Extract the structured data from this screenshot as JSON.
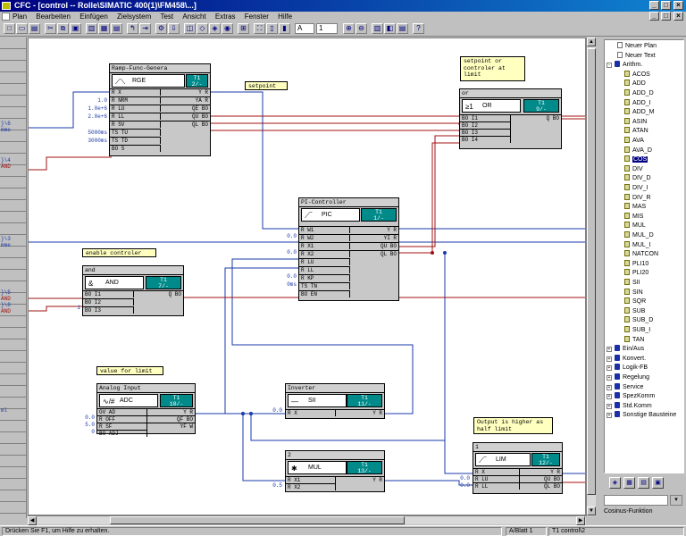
{
  "window": {
    "title": "CFC - [control -- Rolle\\SIMATIC 400(1)\\FM458\\...]",
    "min": "_",
    "max": "□",
    "close": "×",
    "inner_min": "_",
    "inner_max": "□",
    "inner_close": "×"
  },
  "menu": [
    "Plan",
    "Bearbeiten",
    "Einfügen",
    "Zielsystem",
    "Test",
    "Ansicht",
    "Extras",
    "Fenster",
    "Hilfe"
  ],
  "toolbar": {
    "sheet_value": "A",
    "page_value": "1"
  },
  "ruler_labels": [
    {
      "id": "r1",
      "lines": [
        "}\\6",
        "mme"
      ]
    },
    {
      "id": "r2",
      "lines": [
        "}\\4",
        "AND"
      ]
    },
    {
      "id": "r3",
      "lines": [
        "}\\3",
        "mme"
      ]
    },
    {
      "id": "r4",
      "lines": [
        "}\\5",
        "AND",
        "}\\8",
        "AND"
      ]
    },
    {
      "id": "r5",
      "lines": [
        "ml"
      ]
    }
  ],
  "notes": {
    "setpoint": "setpoint",
    "or_note": "setpoint or\ncontroler at\nlimit",
    "enable": "enable controler",
    "value_limit": "value for limit",
    "output_limit": "Output is higher as\nhalf limit"
  },
  "blocks": {
    "ramp": {
      "header": "Ramp-Func-Genera",
      "symbol": "RGE",
      "num1": "T1",
      "num2": "2/-",
      "inputs": [
        "R  X",
        "R  NRM",
        "R  LU",
        "R  LL",
        "R  SV",
        "TS TU",
        "TS TD",
        "BO S"
      ],
      "outputs": [
        "Y  R",
        "YA  R",
        "QE BO",
        "QU BO",
        "QL BO"
      ],
      "input_values": {
        "nrm": "1.0",
        "lu": "1.0e+6",
        "ll": "2.0e+6",
        "tu": "5000ms",
        "td": "3000ms"
      }
    },
    "or": {
      "header": "or",
      "symbol": "OR",
      "num1": "T1",
      "num2": "9/-",
      "inputs": [
        "BO I1",
        "BO I2",
        "BO I3",
        "BO I4"
      ],
      "outputs": [
        "Q BO"
      ]
    },
    "pic": {
      "header": "PI-Controller",
      "symbol": "PIC",
      "num1": "T1",
      "num2": "1/-",
      "inputs": [
        "R  W1",
        "R  W2",
        "R  X1",
        "R  X2",
        "R  LU",
        "R  LL",
        "R  KP",
        "TS TN",
        "BO EN"
      ],
      "outputs": [
        "Y  R",
        "YI  R",
        "QU BO",
        "QL BO"
      ],
      "input_values": {
        "w2": "0.0",
        "x2": "0.0",
        "kp": "0.0",
        "tn": "0ms"
      }
    },
    "and": {
      "header": "and",
      "symbol": "AND",
      "num1": "T1",
      "num2": "7/-",
      "inputs": [
        "BO I1",
        "BO I2",
        "BO I3"
      ],
      "outputs": [
        "Q BO"
      ],
      "input_values": {
        "i3": "1"
      }
    },
    "adc": {
      "header": "Analog Input",
      "symbol": "ADC",
      "num1": "T1",
      "num2": "10/-",
      "inputs": [
        "GV AD",
        "R  OFF",
        "R  SF",
        "BO ADJ"
      ],
      "outputs": [
        "Y  R",
        "QF BO",
        "YF  W"
      ],
      "input_values": {
        "off": "0.0",
        "sf": "5.0",
        "adj": "0"
      }
    },
    "inv": {
      "header": "Inverter",
      "symbol": "SII",
      "num1": "T1",
      "num2": "11/-",
      "inputs": [
        "R  X"
      ],
      "outputs": [
        "Y  R"
      ],
      "input_values": {
        "x": "0.0"
      }
    },
    "mul": {
      "header": "2",
      "symbol": "MUL",
      "num1": "T1",
      "num2": "13/-",
      "inputs": [
        "R  X1",
        "R  X2"
      ],
      "outputs": [
        "Y  R"
      ],
      "input_values": {
        "x2": "0.5"
      }
    },
    "lim": {
      "header": "1",
      "symbol": "LIM",
      "num1": "T1",
      "num2": "12/-",
      "inputs": [
        "R  X",
        "R  LU",
        "R  LL"
      ],
      "outputs": [
        "Y  R",
        "QU BO",
        "QL BO"
      ],
      "input_values": {
        "lu": "0.0",
        "ll": "0.0"
      }
    }
  },
  "catalog": {
    "items": [
      {
        "label": "Neuer Plan",
        "icon": "page"
      },
      {
        "label": "Neuer Text",
        "icon": "page"
      },
      {
        "label": "Arithm.",
        "icon": "book",
        "expander": "-"
      },
      {
        "label": "ACOS",
        "icon": "block"
      },
      {
        "label": "ADD",
        "icon": "block"
      },
      {
        "label": "ADD_D",
        "icon": "block"
      },
      {
        "label": "ADD_I",
        "icon": "block"
      },
      {
        "label": "ADD_M",
        "icon": "block"
      },
      {
        "label": "ASIN",
        "icon": "block"
      },
      {
        "label": "ATAN",
        "icon": "block"
      },
      {
        "label": "AVA",
        "icon": "block"
      },
      {
        "label": "AVA_D",
        "icon": "block"
      },
      {
        "label": "COS",
        "icon": "block",
        "selected": true
      },
      {
        "label": "DIV",
        "icon": "block"
      },
      {
        "label": "DIV_D",
        "icon": "block"
      },
      {
        "label": "DIV_I",
        "icon": "block"
      },
      {
        "label": "DIV_R",
        "icon": "block"
      },
      {
        "label": "MAS",
        "icon": "block"
      },
      {
        "label": "MIS",
        "icon": "block"
      },
      {
        "label": "MUL",
        "icon": "block"
      },
      {
        "label": "MUL_D",
        "icon": "block"
      },
      {
        "label": "MUL_I",
        "icon": "block"
      },
      {
        "label": "NATCON",
        "icon": "block"
      },
      {
        "label": "PLI10",
        "icon": "block"
      },
      {
        "label": "PLI20",
        "icon": "block"
      },
      {
        "label": "SII",
        "icon": "block"
      },
      {
        "label": "SIN",
        "icon": "block"
      },
      {
        "label": "SQR",
        "icon": "block"
      },
      {
        "label": "SUB",
        "icon": "block"
      },
      {
        "label": "SUB_D",
        "icon": "block"
      },
      {
        "label": "SUB_I",
        "icon": "block"
      },
      {
        "label": "TAN",
        "icon": "block"
      },
      {
        "label": "Ein/Aus",
        "icon": "book",
        "expander": "+"
      },
      {
        "label": "Konvert.",
        "icon": "book",
        "expander": "+"
      },
      {
        "label": "Logik-FB",
        "icon": "book",
        "expander": "+"
      },
      {
        "label": "Regelung",
        "icon": "book",
        "expander": "+"
      },
      {
        "label": "Service",
        "icon": "book",
        "expander": "+"
      },
      {
        "label": "SpezKomm",
        "icon": "book",
        "expander": "+"
      },
      {
        "label": "Std.Komm",
        "icon": "book",
        "expander": "+"
      },
      {
        "label": "Sonstige Bausteine",
        "icon": "book",
        "expander": "+"
      }
    ],
    "function_label": "Cosinus-Funktion"
  },
  "status": {
    "help": "Drücken Sie F1, um Hilfe zu erhalten.",
    "sheet": "A/Blatt 1",
    "task": "T1   control\\2"
  },
  "colors": {
    "wire_blue": "#1a3aa8",
    "wire_red": "#a01010",
    "block_number": "#008a8a",
    "note_bg": "#ffffc0",
    "title_bar": "#000080"
  }
}
